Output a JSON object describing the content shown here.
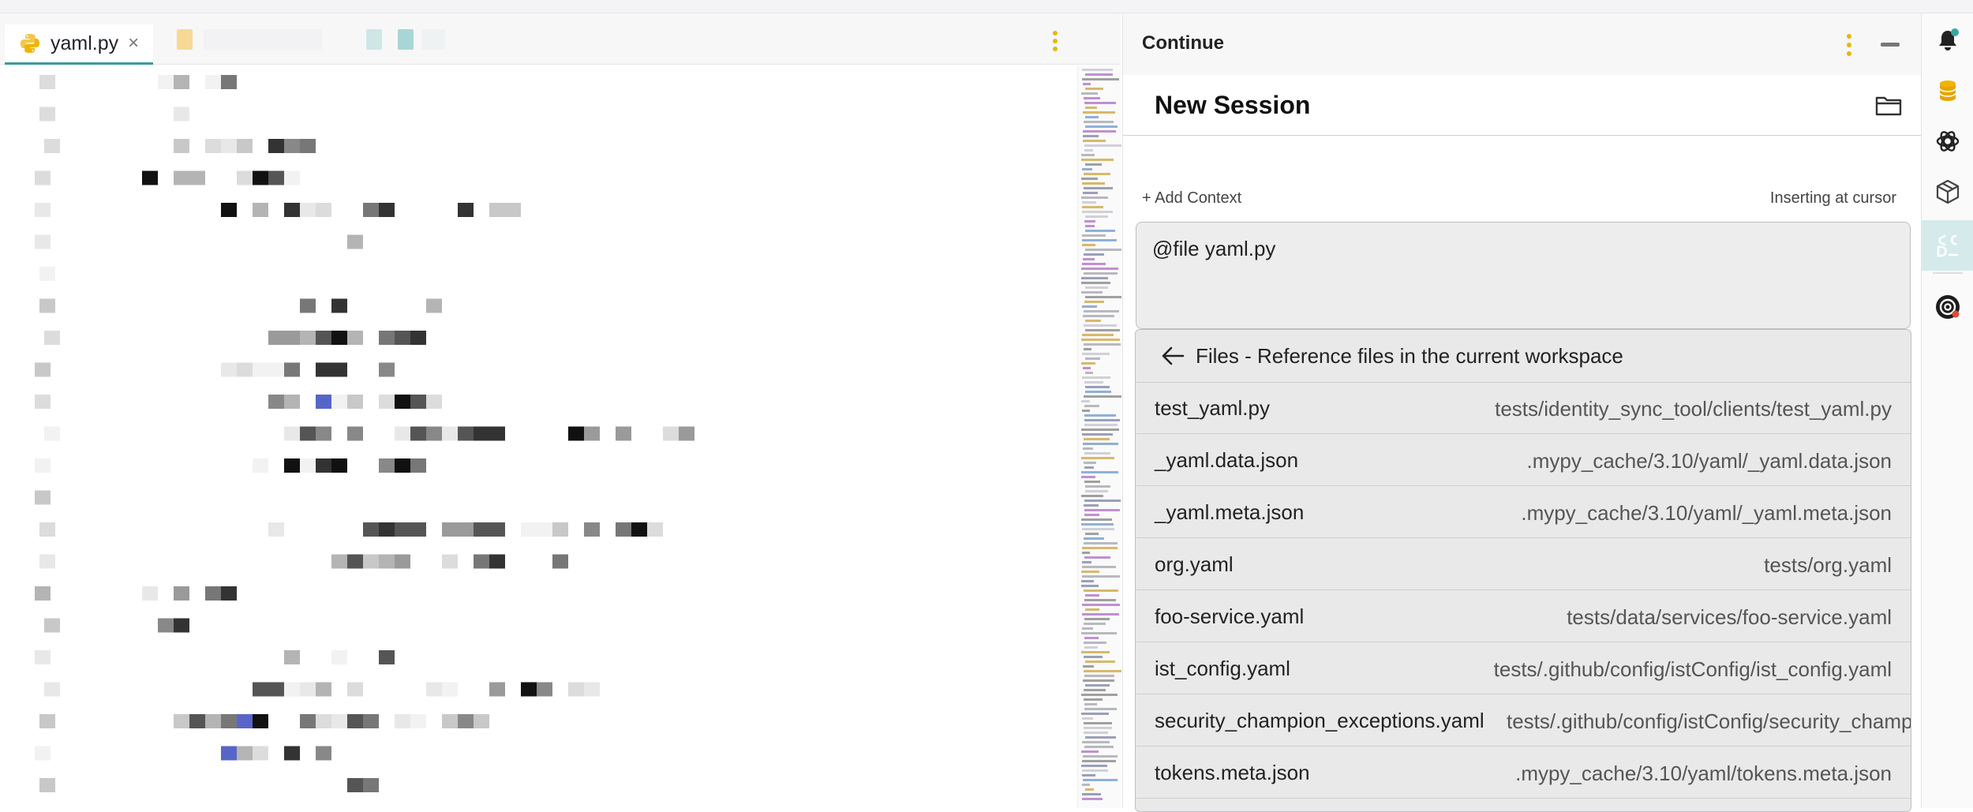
{
  "editor": {
    "tab": {
      "title": "yaml.py",
      "icon": "python-file-icon",
      "close": "×"
    }
  },
  "panel": {
    "title": "Continue",
    "session_title": "New Session",
    "add_context": "+ Add Context",
    "insert_mode": "Inserting at cursor",
    "input_value": "@file yaml.py",
    "dropdown": {
      "header": "Files - Reference files in the current workspace",
      "items": [
        {
          "name": "test_yaml.py",
          "path": "tests/identity_sync_tool/clients/test_yaml.py"
        },
        {
          "name": "_yaml.data.json",
          "path": ".mypy_cache/3.10/yaml/_yaml.data.json"
        },
        {
          "name": "_yaml.meta.json",
          "path": ".mypy_cache/3.10/yaml/_yaml.meta.json"
        },
        {
          "name": "org.yaml",
          "path": "tests/org.yaml"
        },
        {
          "name": "foo-service.yaml",
          "path": "tests/data/services/foo-service.yaml"
        },
        {
          "name": "ist_config.yaml",
          "path": "tests/.github/config/istConfig/ist_config.yaml"
        },
        {
          "name": "security_champion_exceptions.yaml",
          "path": "tests/.github/config/istConfig/security_champion_exceptions.yaml"
        },
        {
          "name": "tokens.meta.json",
          "path": ".mypy_cache/3.10/yaml/tokens.meta.json"
        }
      ]
    }
  },
  "activity_bar": {
    "icons": [
      "bell-icon",
      "database-icon",
      "openai-icon",
      "package-icon",
      "continue-icon",
      "at-sign-icon"
    ]
  },
  "colors": {
    "accent": "#3d9a9a",
    "dots": "#e6b800",
    "active_bg": "#d5ebeb"
  }
}
